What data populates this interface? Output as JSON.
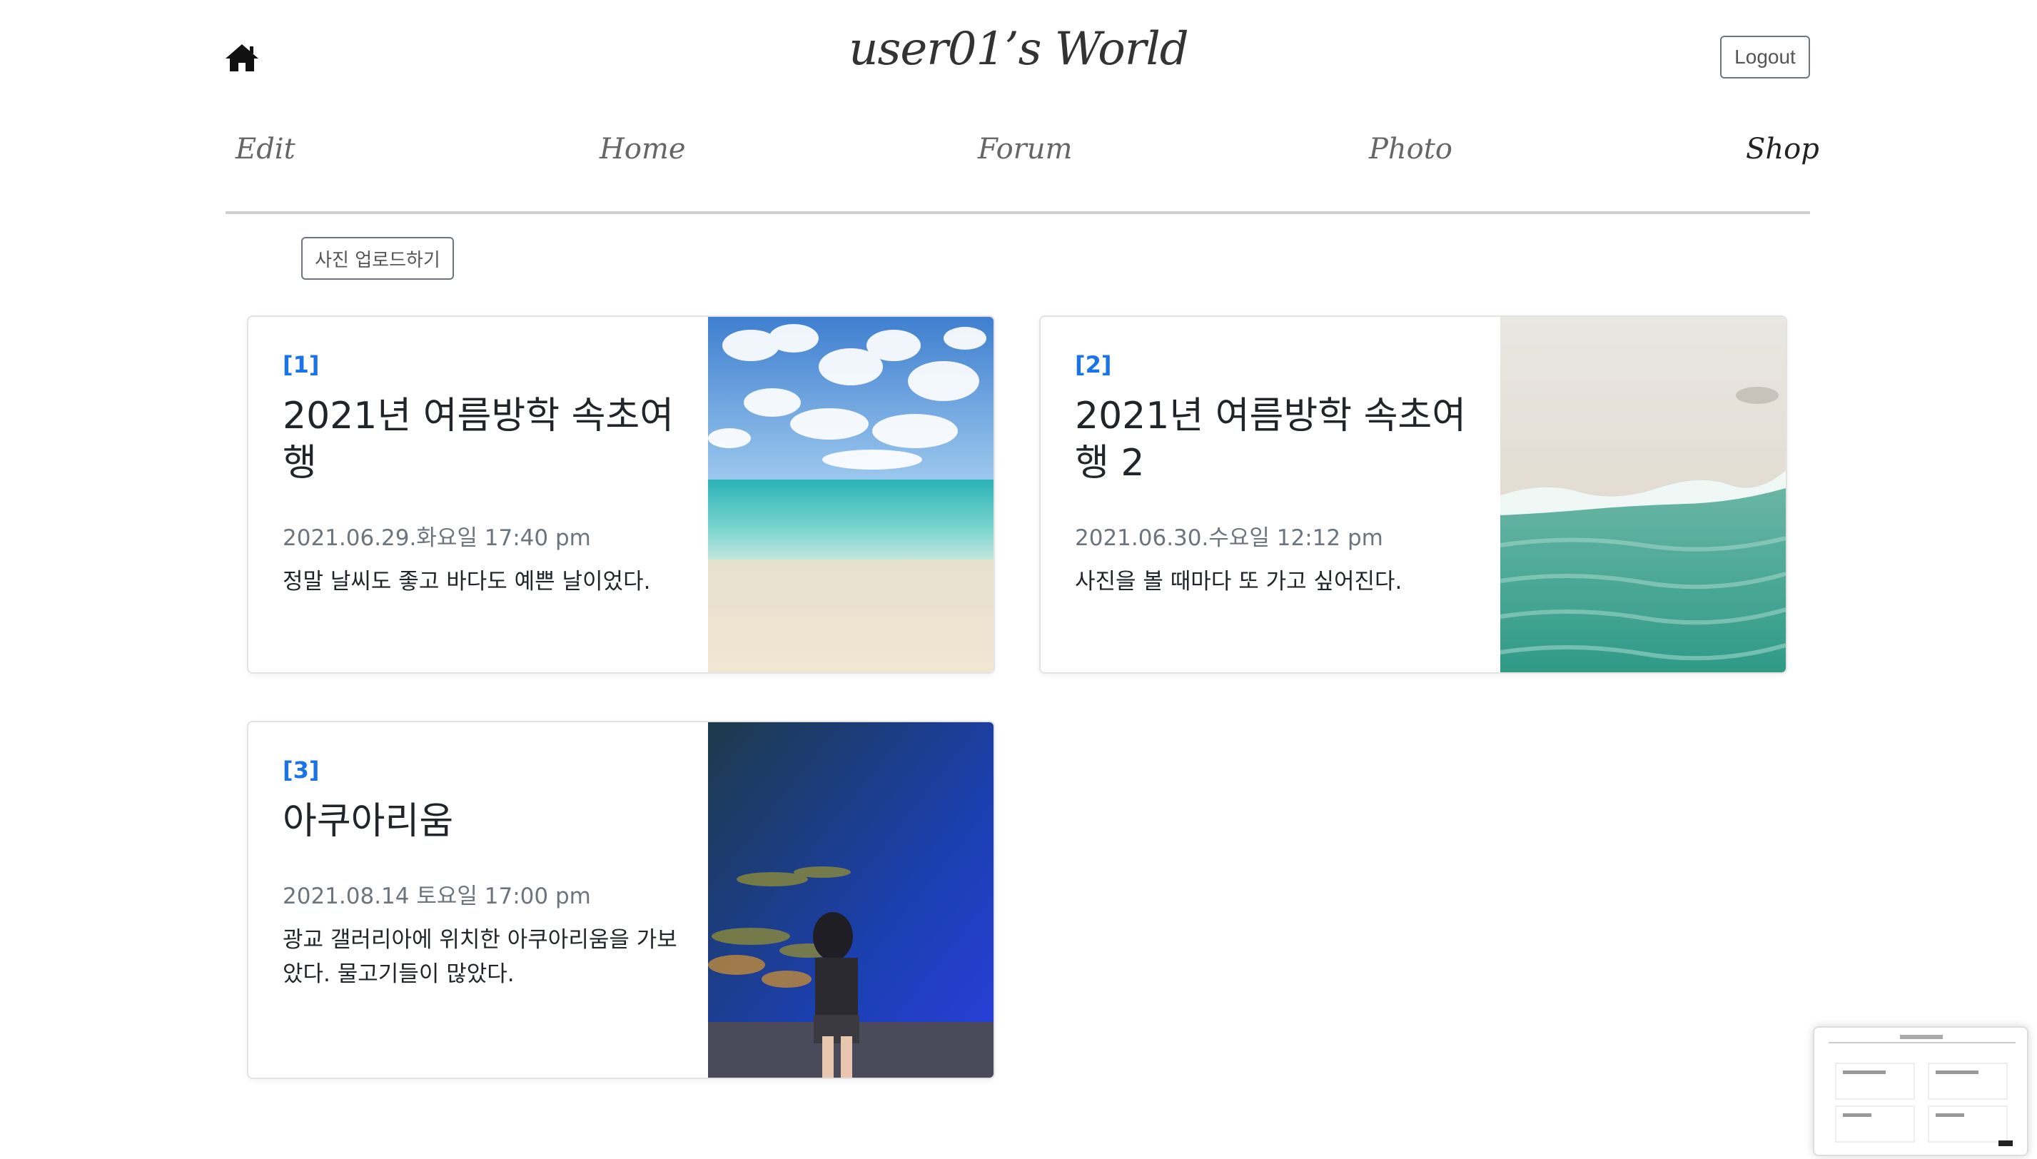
{
  "header": {
    "title": "user01’s World",
    "logout_label": "Logout",
    "home_icon": "home-icon"
  },
  "nav": {
    "items": [
      {
        "label": "Edit"
      },
      {
        "label": "Home"
      },
      {
        "label": "Forum"
      },
      {
        "label": "Photo"
      },
      {
        "label": "Shop"
      }
    ]
  },
  "upload_label": "사진 업로드하기",
  "posts": [
    {
      "num": "[1]",
      "title": "2021년 여름방학 속초여행",
      "date": "2021.06.29.화요일 17:40 pm",
      "text": "정말 날씨도 좋고 바다도 예쁜 날이었다.",
      "image": "beach-sky-photo"
    },
    {
      "num": "[2]",
      "title": "2021년 여름방학 속초여행 2",
      "date": "2021.06.30.수요일 12:12 pm",
      "text": "사진을 볼 때마다 또 가고 싶어진다.",
      "image": "aerial-shore-photo"
    },
    {
      "num": "[3]",
      "title": "아쿠아리움",
      "date": "2021.08.14 토요일 17:00 pm",
      "text": "광교 갤러리아에 위치한 아쿠아리움을 가보았다. 물고기들이 많았다.",
      "image": "aquarium-photo"
    }
  ],
  "colors": {
    "accent": "#1a73e8",
    "muted": "#6c757d",
    "border": "#e3e3e3"
  }
}
